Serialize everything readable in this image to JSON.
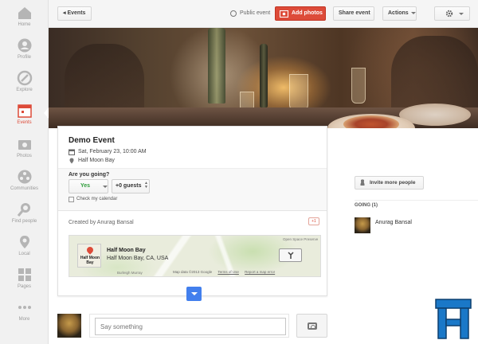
{
  "sidebar": {
    "items": [
      {
        "label": "Home",
        "icon": "home-icon"
      },
      {
        "label": "Profile",
        "icon": "profile-icon"
      },
      {
        "label": "Explore",
        "icon": "explore-icon"
      },
      {
        "label": "Events",
        "icon": "events-icon",
        "active": true
      },
      {
        "label": "Photos",
        "icon": "photos-icon"
      },
      {
        "label": "Communities",
        "icon": "communities-icon"
      },
      {
        "label": "Find people",
        "icon": "find-people-icon"
      },
      {
        "label": "Local",
        "icon": "local-icon"
      },
      {
        "label": "Pages",
        "icon": "pages-icon"
      },
      {
        "label": "More",
        "icon": "more-icon"
      }
    ]
  },
  "toolbar": {
    "back_label": "Events",
    "public_label": "Public event",
    "add_photos_label": "Add photos",
    "share_label": "Share event",
    "actions_label": "Actions"
  },
  "event": {
    "title": "Demo Event",
    "datetime": "Sat, February 23, 10:00 AM",
    "location": "Half Moon Bay",
    "rsvp_question": "Are you going?",
    "rsvp_value": "Yes",
    "guests_value": "+0 guests",
    "check_calendar": "Check my calendar",
    "created_by": "Created by Anurag Bansal",
    "plus_one": "+1"
  },
  "map": {
    "thumb_label": "Half Moon Bay",
    "place_name": "Half Moon Bay",
    "address": "Half Moon Bay, CA, USA",
    "label_open_space": "Open Space Preserve",
    "label_burleigh": "Burleigh Murray",
    "credit": "Map data ©2013 Google",
    "terms": "Terms of Use",
    "report": "Report a map error"
  },
  "comment": {
    "placeholder": "Say something"
  },
  "guests": {
    "invite_label": "Invite more people",
    "going_header": "GOING (1)",
    "attendees": [
      "Anurag Bansal"
    ]
  },
  "colors": {
    "accent_red": "#dd4b39",
    "yes_green": "#2e9d3b",
    "expand_blue": "#427fed"
  }
}
